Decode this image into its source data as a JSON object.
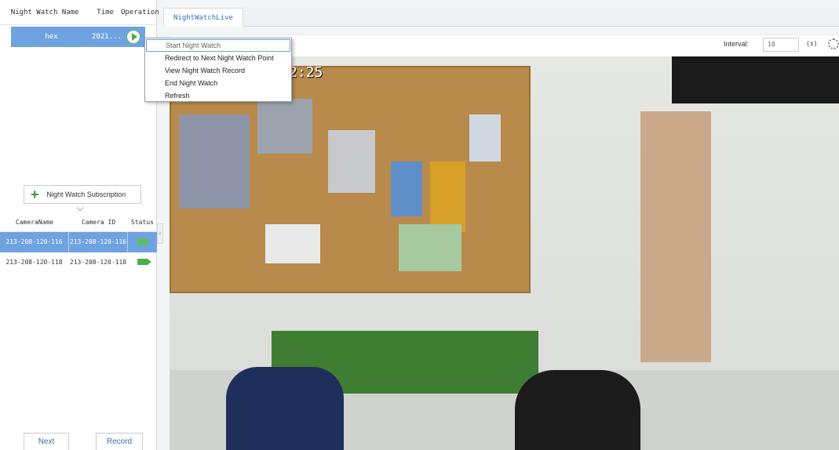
{
  "night_watch_table": {
    "headers": [
      "Night Watch Name",
      "Time",
      "Operation"
    ],
    "rows": [
      {
        "name": "hex",
        "time": "2021..."
      }
    ]
  },
  "subscription_button": {
    "label": "Night Watch Subscription"
  },
  "camera_table": {
    "headers": [
      "CameraName",
      "Camera ID",
      "Status"
    ],
    "rows": [
      {
        "name": "213-208-120-116",
        "id": "213-208-120-116",
        "status_icon": "camera-icon"
      },
      {
        "name": "213-208-120-118",
        "id": "213-208-120-118",
        "status_icon": "camera-icon"
      }
    ]
  },
  "footer": {
    "next_label": "Next",
    "record_event_label": "Record Event"
  },
  "tabs": [
    {
      "label": "NightWatchLive"
    }
  ],
  "toolbar": {
    "interval_label": "Interval:",
    "interval_value": "10",
    "unit": "(s)"
  },
  "video": {
    "time_overlay": "2:25"
  },
  "context_menu": {
    "items": [
      "Start Night Watch",
      "Redirect to Next Night Watch Point",
      "View Night Watch Record",
      "End Night Watch",
      "Refresh"
    ]
  },
  "colors": {
    "selection": "#6fa3e0",
    "accent_green": "#4cae4c",
    "tab_text": "#2f6fb8"
  }
}
